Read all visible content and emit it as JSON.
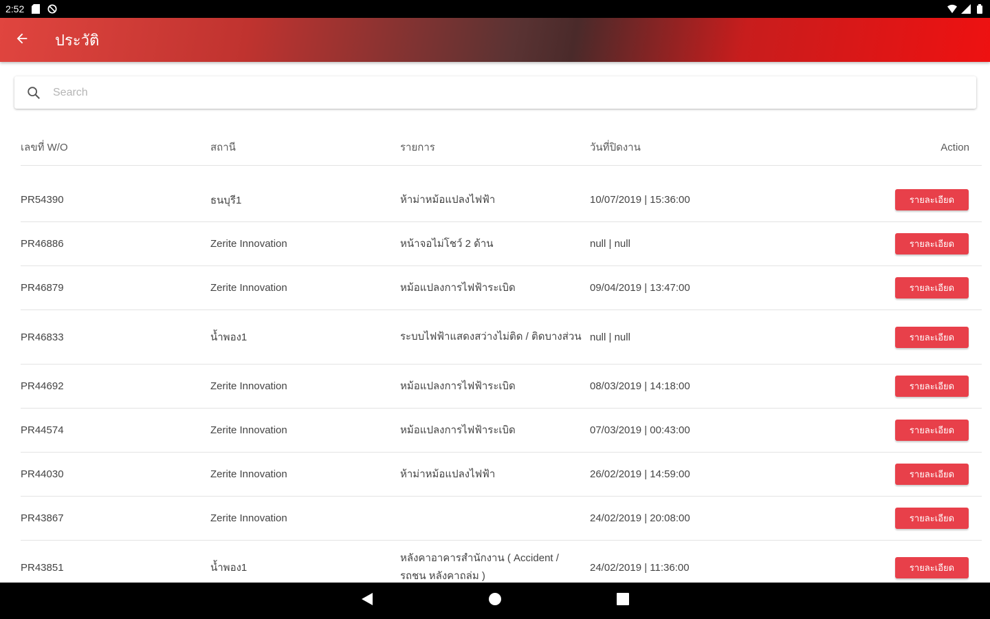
{
  "status_bar": {
    "time": "2:52"
  },
  "app_bar": {
    "title": "ประวัติ"
  },
  "search": {
    "placeholder": "Search",
    "value": ""
  },
  "table": {
    "headers": {
      "wo": "เลขที่ W/O",
      "name": "สถานี",
      "item": "รายการ",
      "date": "วันที่ปิดงาน",
      "action": "Action"
    },
    "button_label": "รายละเอียด",
    "rows": [
      {
        "wo": "PR54390",
        "name": "ธนบุรี1",
        "item": "ห้าม่าหม้อแปลงไฟฟ้า",
        "date": "10/07/2019 | 15:36:00"
      },
      {
        "wo": "PR46886",
        "name": "Zerite Innovation",
        "item": "หน้าจอไม่โชว์ 2 ด้าน",
        "date": "null | null"
      },
      {
        "wo": "PR46879",
        "name": "Zerite Innovation",
        "item": "หม้อแปลงการไฟฟ้าระเบิด",
        "date": "09/04/2019 | 13:47:00"
      },
      {
        "wo": "PR46833",
        "name": "น้ำพอง1",
        "item": "ระบบไฟฟ้าแสดงสว่างไม่ติด / ติดบางส่วน",
        "date": "null | null"
      },
      {
        "wo": "PR44692",
        "name": "Zerite Innovation",
        "item": "หม้อแปลงการไฟฟ้าระเบิด",
        "date": "08/03/2019 | 14:18:00"
      },
      {
        "wo": "PR44574",
        "name": "Zerite Innovation",
        "item": "หม้อแปลงการไฟฟ้าระเบิด",
        "date": "07/03/2019 | 00:43:00"
      },
      {
        "wo": "PR44030",
        "name": "Zerite Innovation",
        "item": "ห้าม่าหม้อแปลงไฟฟ้า",
        "date": "26/02/2019 | 14:59:00"
      },
      {
        "wo": "PR43867",
        "name": "Zerite Innovation",
        "item": "",
        "date": "24/02/2019 | 20:08:00"
      },
      {
        "wo": "PR43851",
        "name": "น้ำพอง1",
        "item": "หลังคาอาคารสำนักงาน ( Accident / รถชน หลังคาถล่ม )",
        "date": "24/02/2019 | 11:36:00"
      }
    ]
  }
}
